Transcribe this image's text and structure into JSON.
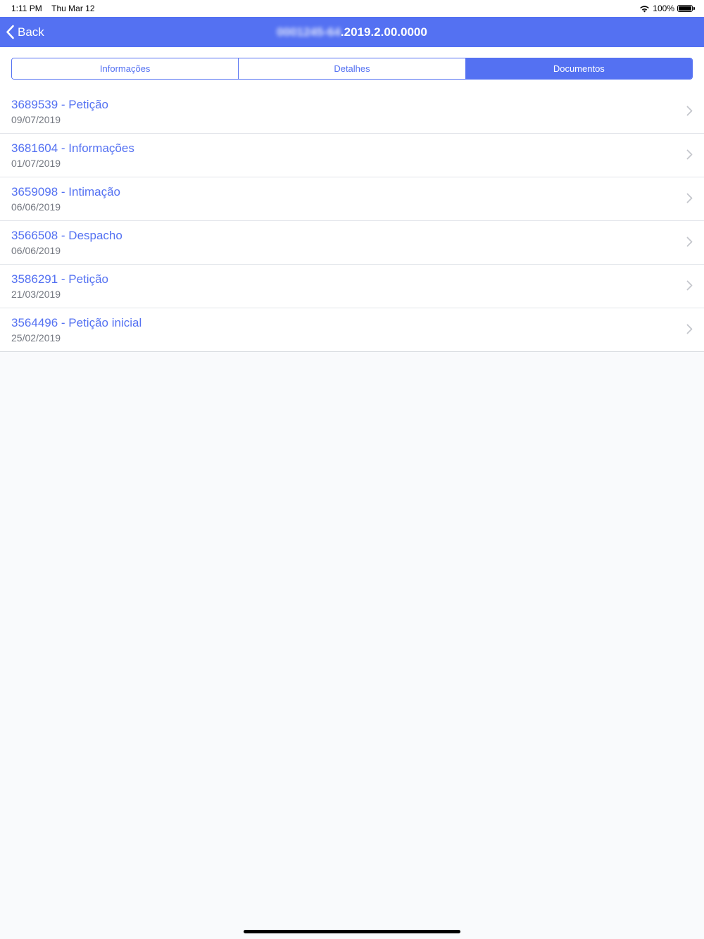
{
  "status_bar": {
    "time": "1:11 PM",
    "date": "Thu Mar 12",
    "battery": "100%",
    "battery_level": 1.0
  },
  "nav": {
    "back_label": "Back",
    "title_redacted": "0001245-64",
    "title_visible": ".2019.2.00.0000"
  },
  "tabs": [
    {
      "label": "Informações",
      "active": false
    },
    {
      "label": "Detalhes",
      "active": false
    },
    {
      "label": "Documentos",
      "active": true
    }
  ],
  "documents": [
    {
      "title": "3689539 - Petição",
      "date": "09/07/2019"
    },
    {
      "title": "3681604 - Informações",
      "date": "01/07/2019"
    },
    {
      "title": "3659098 - Intimação",
      "date": "06/06/2019"
    },
    {
      "title": "3566508 - Despacho",
      "date": "06/06/2019"
    },
    {
      "title": "3586291 - Petição",
      "date": "21/03/2019"
    },
    {
      "title": "3564496 - Petição inicial",
      "date": "25/02/2019"
    }
  ],
  "colors": {
    "accent": "#5471f2",
    "background": "#f9fafc",
    "secondary_text": "#737780"
  }
}
